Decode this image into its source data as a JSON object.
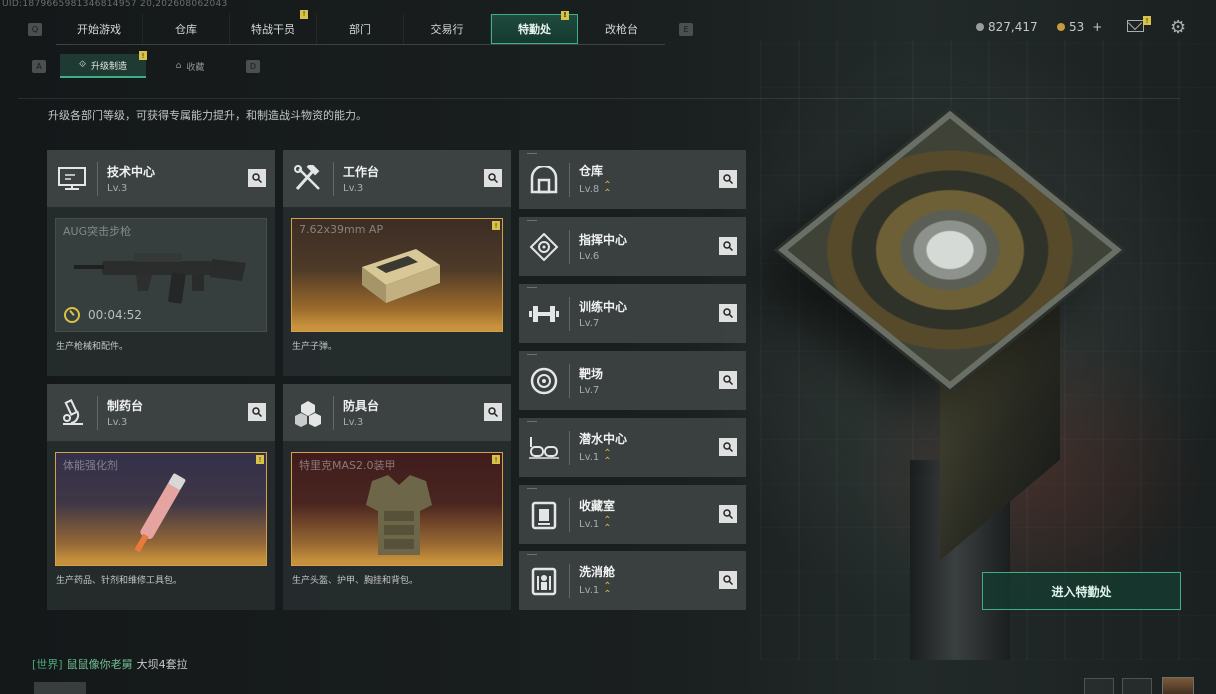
{
  "uid": "UID:1879665981346814957 20,202608062043",
  "nav": {
    "left_key": "Q",
    "right_key": "E",
    "tabs": [
      {
        "label": "开始游戏",
        "active": false,
        "badge": false
      },
      {
        "label": "仓库",
        "active": false,
        "badge": false
      },
      {
        "label": "特战干员",
        "active": false,
        "badge": true
      },
      {
        "label": "部门",
        "active": false,
        "badge": false
      },
      {
        "label": "交易行",
        "active": false,
        "badge": false
      },
      {
        "label": "特勤处",
        "active": true,
        "badge": true
      },
      {
        "label": "改枪台",
        "active": false,
        "badge": false
      }
    ],
    "badge_text": "!"
  },
  "currency": {
    "silver": "827,417",
    "gold": "53",
    "gold_plus": "+"
  },
  "subnav": {
    "left_key": "A",
    "right_key": "D",
    "tabs": [
      {
        "label": "升级制造",
        "active": true
      },
      {
        "label": "收藏",
        "active": false
      }
    ]
  },
  "description": "升级各部门等级，可获得专属能力提升，和制造战斗物资的能力。",
  "big_cards": [
    {
      "name": "技术中心",
      "level": "Lv.3",
      "item": "AUG突击步枪",
      "timer": "00:04:52",
      "footer": "生产枪械和配件。",
      "theme": "grey",
      "badge": false
    },
    {
      "name": "工作台",
      "level": "Lv.3",
      "item": "7.62x39mm AP",
      "timer": "",
      "footer": "生产子弹。",
      "theme": "orange",
      "badge": true
    },
    {
      "name": "制药台",
      "level": "Lv.3",
      "item": "体能强化剂",
      "timer": "",
      "footer": "生产药品、针剂和维修工具包。",
      "theme": "purple",
      "badge": true
    },
    {
      "name": "防具台",
      "level": "Lv.3",
      "item": "特里克MAS2.0装甲",
      "timer": "",
      "footer": "生产头盔、护甲、胸挂和背包。",
      "theme": "red",
      "badge": true
    }
  ],
  "list_cards": [
    {
      "name": "仓库",
      "level": "Lv.8",
      "upgrade": true,
      "icon": "warehouse-icon"
    },
    {
      "name": "指挥中心",
      "level": "Lv.6",
      "upgrade": false,
      "icon": "command-center-icon"
    },
    {
      "name": "训练中心",
      "level": "Lv.7",
      "upgrade": false,
      "icon": "dumbbell-icon"
    },
    {
      "name": "靶场",
      "level": "Lv.7",
      "upgrade": false,
      "icon": "target-icon"
    },
    {
      "name": "潜水中心",
      "level": "Lv.1",
      "upgrade": true,
      "icon": "diving-goggles-icon"
    },
    {
      "name": "收藏室",
      "level": "Lv.1",
      "upgrade": true,
      "icon": "collection-room-icon"
    },
    {
      "name": "洗消舱",
      "level": "Lv.1",
      "upgrade": true,
      "icon": "decontamination-icon"
    }
  ],
  "enter_button": "进入特勤处",
  "chat": {
    "channel": "[世界]",
    "sender": "鼠鼠像你老舅",
    "message": "大坝4套拉"
  },
  "colors": {
    "accent": "#3fae85",
    "badge": "#d8c24a",
    "upgrade": "#d9b648"
  }
}
